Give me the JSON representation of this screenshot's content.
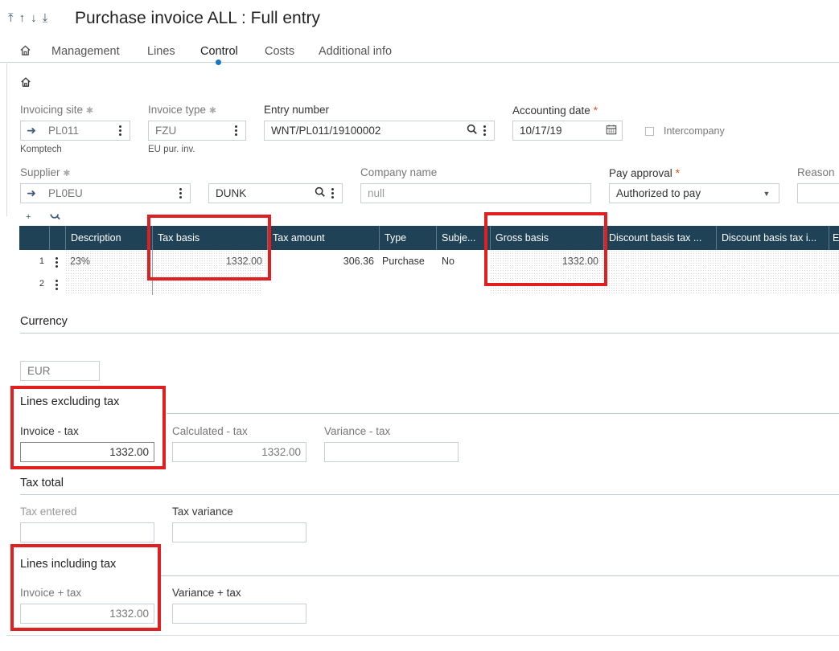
{
  "header": {
    "nav": [
      "⤒",
      "↑",
      "↓",
      "⤓"
    ],
    "title": "Purchase invoice ALL : Full entry"
  },
  "tabs": [
    {
      "label": "Management"
    },
    {
      "label": "Lines"
    },
    {
      "label": "Control"
    },
    {
      "label": "Costs"
    },
    {
      "label": "Additional info"
    }
  ],
  "active_tab": "Control",
  "form": {
    "invoicing_site": {
      "label": "Invoicing site",
      "value": "PL011",
      "sub": "Komptech"
    },
    "invoice_type": {
      "label": "Invoice type",
      "value": "FZU",
      "sub": "EU pur. inv."
    },
    "entry_number": {
      "label": "Entry number",
      "value": "WNT/PL011/19100002"
    },
    "accounting_date": {
      "label": "Accounting date",
      "value": "10/17/19"
    },
    "intercompany": {
      "label": "Intercompany",
      "checked": false
    },
    "supplier": {
      "label": "Supplier",
      "value": "PL0EU",
      "code": "DUNK"
    },
    "company_name": {
      "label": "Company name",
      "placeholder": "null"
    },
    "pay_approval": {
      "label": "Pay approval",
      "value": "Authorized to pay"
    },
    "reason": {
      "label": "Reason"
    }
  },
  "grid": {
    "columns": [
      "Description",
      "Tax basis",
      "Tax amount",
      "Type",
      "Subje...",
      "Gross basis",
      "Discount basis tax ...",
      "Discount basis tax i...",
      "E:"
    ],
    "rows": [
      {
        "num": "1",
        "description": "23%",
        "tax_basis": "1332.00",
        "tax_amount": "306.36",
        "type": "Purchase",
        "subject": "No",
        "gross_basis": "1332.00"
      },
      {
        "num": "2",
        "description": "",
        "tax_basis": "",
        "tax_amount": "",
        "type": "",
        "subject": "",
        "gross_basis": ""
      }
    ]
  },
  "currency": {
    "title": "Currency",
    "value": "EUR"
  },
  "lines_excl": {
    "title": "Lines excluding tax",
    "invoice_label": "Invoice - tax",
    "invoice_value": "1332.00",
    "calc_label": "Calculated - tax",
    "calc_value": "1332.00",
    "variance_label": "Variance - tax",
    "variance_value": ""
  },
  "tax_total": {
    "title": "Tax total",
    "entered_label": "Tax entered",
    "entered_value": "",
    "variance_label": "Tax variance",
    "variance_value": ""
  },
  "lines_incl": {
    "title": "Lines including tax",
    "invoice_label": "Invoice + tax",
    "invoice_value": "1332.00",
    "variance_label": "Variance + tax",
    "variance_value": ""
  },
  "colors": {
    "grid_header": "#1f4256",
    "accent": "#1676c4",
    "highlight": "#e02020",
    "required": "#e8541c"
  }
}
